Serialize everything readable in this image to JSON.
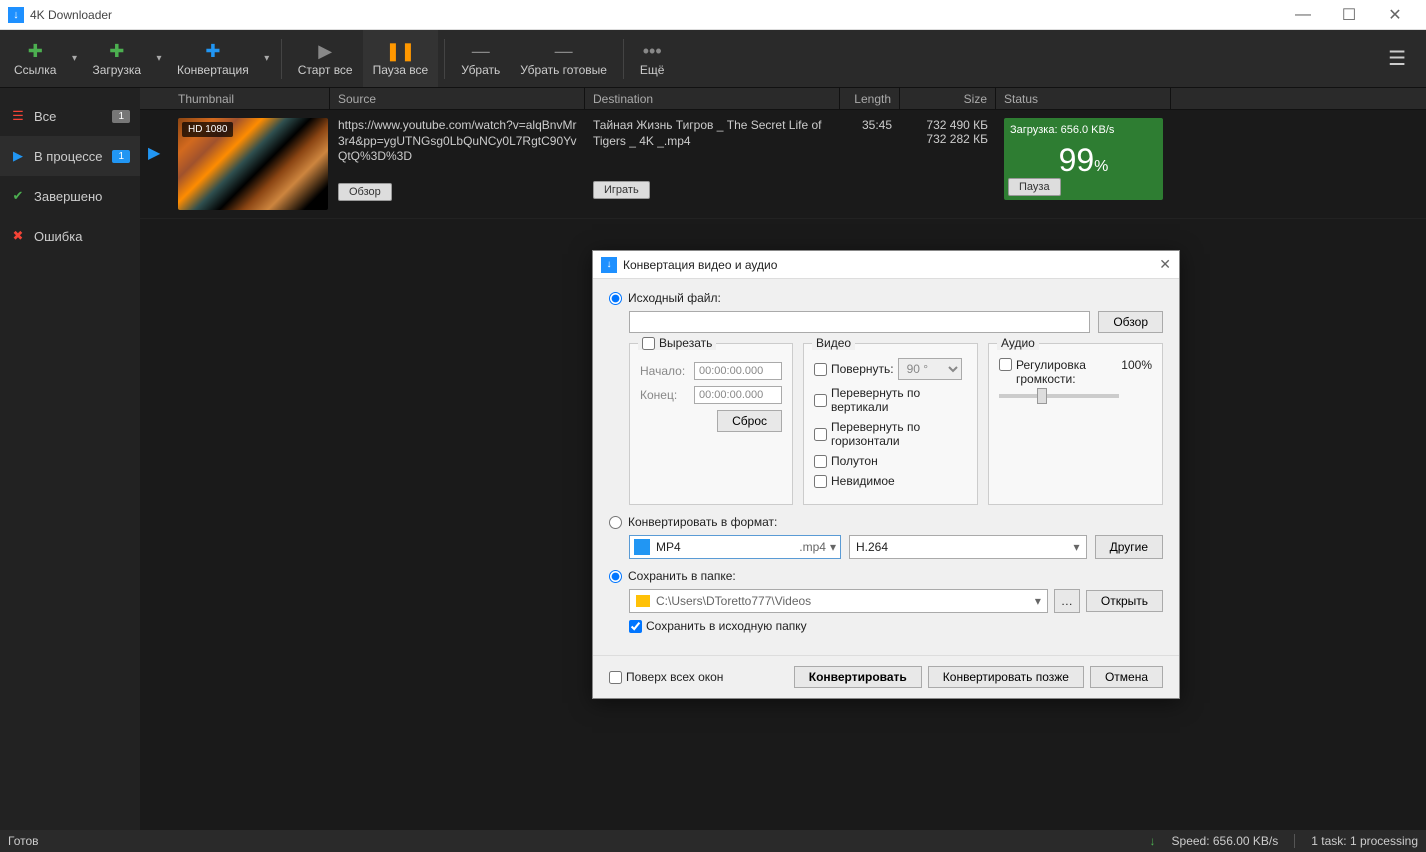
{
  "app": {
    "title": "4K Downloader"
  },
  "toolbar": {
    "link": "Ссылка",
    "download": "Загрузка",
    "convert": "Конвертация",
    "start_all": "Старт все",
    "pause_all": "Пауза все",
    "remove": "Убрать",
    "remove_done": "Убрать готовые",
    "more": "Ещё"
  },
  "sidebar": {
    "all": {
      "label": "Все",
      "badge": "1"
    },
    "inprogress": {
      "label": "В процессе",
      "badge": "1"
    },
    "done": {
      "label": "Завершено"
    },
    "error": {
      "label": "Ошибка"
    }
  },
  "columns": {
    "thumb": "Thumbnail",
    "source": "Source",
    "dest": "Destination",
    "length": "Length",
    "size": "Size",
    "status": "Status"
  },
  "row": {
    "thumb_badge": "HD 1080",
    "source": "https://www.youtube.com/watch?v=alqBnvMr3r4&pp=ygUTNGsg0LbQuNCy0L7RgtC90YvQtQ%3D%3D",
    "obзор_btn": "Обзор",
    "dest": "Тайная Жизнь Тигров _ The Secret Life of Tigers _ 4K _.mp4",
    "play_btn": "Играть",
    "length": "35:45",
    "size1": "732 490 КБ",
    "size2": "732 282 КБ",
    "status_text": "Загрузка: 656.0 KB/s",
    "status_pct": "99",
    "status_pct_sym": "%",
    "pause_btn": "Пауза"
  },
  "dialog": {
    "title": "Конвертация видео и аудио",
    "source_label": "Исходный файл:",
    "browse_btn": "Обзор",
    "cut": {
      "checkbox": "Вырезать",
      "start_label": "Начало:",
      "start_val": "00:00:00.000",
      "end_label": "Конец:",
      "end_val": "00:00:00.000",
      "reset_btn": "Сброс"
    },
    "video": {
      "panel": "Видео",
      "rotate": "Повернуть:",
      "rotate_val": "90 °",
      "flip_v": "Перевернуть по вертикали",
      "flip_h": "Перевернуть по горизонтали",
      "halftone": "Полутон",
      "invisible": "Невидимое"
    },
    "audio": {
      "panel": "Аудио",
      "volume": "Регулировка громкости:",
      "volume_val": "100%"
    },
    "format": {
      "label": "Конвертировать в формат:",
      "container": "MP4",
      "ext": ".mp4",
      "codec": "H.264",
      "others_btn": "Другие"
    },
    "save": {
      "label": "Сохранить в папке:",
      "path": "C:\\Users\\DToretto777\\Videos",
      "open_btn": "Открыть",
      "source_folder": "Сохранить в исходную папку"
    },
    "footer": {
      "on_top": "Поверх всех окон",
      "convert_btn": "Конвертировать",
      "later_btn": "Конвертировать позже",
      "cancel_btn": "Отмена"
    }
  },
  "statusbar": {
    "ready": "Готов",
    "speed": "Speed: 656.00 KB/s",
    "tasks": "1 task: 1 processing"
  }
}
